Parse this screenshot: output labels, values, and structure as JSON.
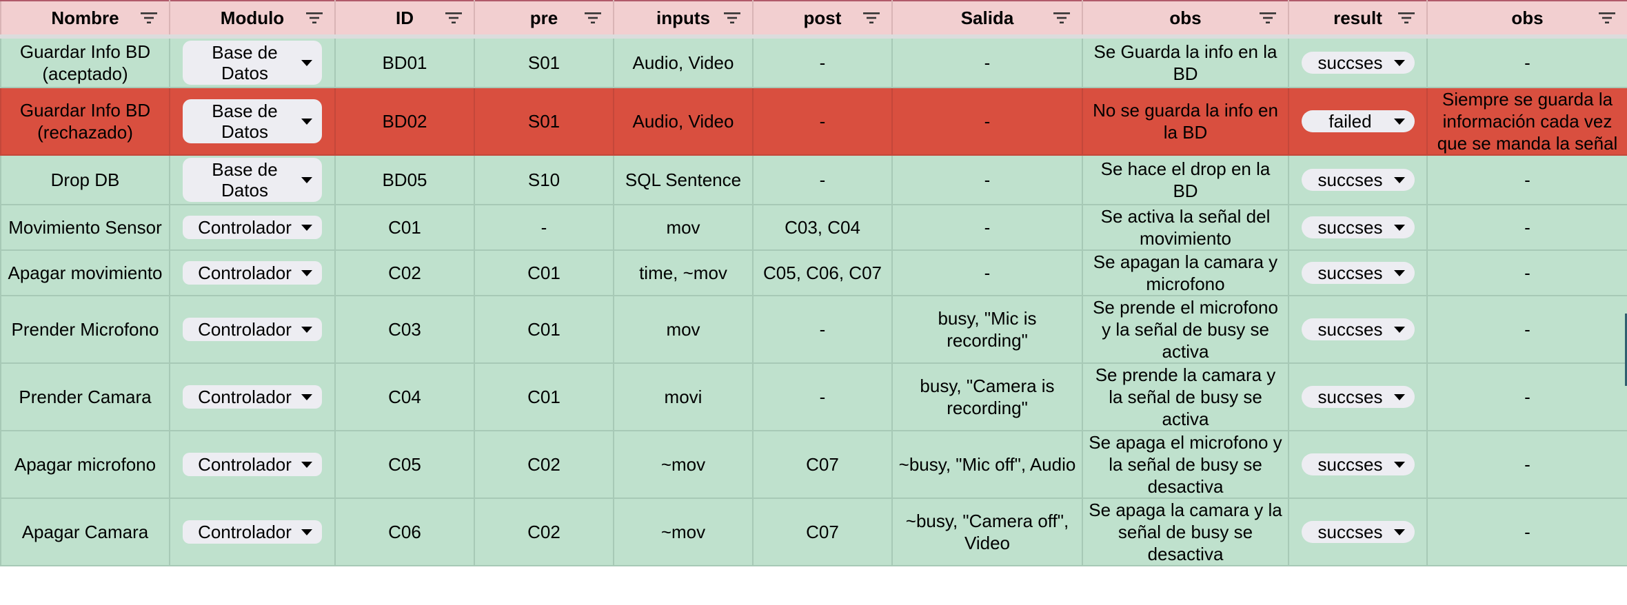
{
  "columns": [
    {
      "label": "Nombre",
      "icon": "filter-icon"
    },
    {
      "label": "Modulo",
      "icon": "filter-icon"
    },
    {
      "label": "ID",
      "icon": "filter-icon"
    },
    {
      "label": "pre",
      "icon": "filter-icon"
    },
    {
      "label": "inputs",
      "icon": "filter-icon"
    },
    {
      "label": "post",
      "icon": "filter-icon"
    },
    {
      "label": "Salida",
      "icon": "filter-icon"
    },
    {
      "label": "obs",
      "icon": "filter-icon"
    },
    {
      "label": "result",
      "icon": "filter-icon"
    },
    {
      "label": "obs",
      "icon": "filter-icon"
    }
  ],
  "rows": [
    {
      "nombre": "Guardar Info BD (aceptado)",
      "modulo": "Base de Datos",
      "id": "BD01",
      "pre": "S01",
      "inputs": "Audio, Video",
      "post": "-",
      "salida": "-",
      "obs": "Se Guarda la info en la BD",
      "result": "succses",
      "obs2": "-",
      "status": "ok"
    },
    {
      "nombre": "Guardar Info BD (rechazado)",
      "modulo": "Base de Datos",
      "id": "BD02",
      "pre": "S01",
      "inputs": "Audio, Video",
      "post": "-",
      "salida": "-",
      "obs": "No se guarda la info en la BD",
      "result": "failed",
      "obs2": "Siempre se guarda la información cada vez que se manda la señal",
      "status": "failed"
    },
    {
      "nombre": "Drop DB",
      "modulo": "Base de Datos",
      "id": "BD05",
      "pre": "S10",
      "inputs": "SQL Sentence",
      "post": "-",
      "salida": "-",
      "obs": "Se hace el drop en la BD",
      "result": "succses",
      "obs2": "-",
      "status": "ok"
    },
    {
      "nombre": "Movimiento Sensor",
      "modulo": "Controlador",
      "id": "C01",
      "pre": "-",
      "inputs": "mov",
      "post": "C03, C04",
      "salida": "-",
      "obs": "Se activa la señal del movimiento",
      "result": "succses",
      "obs2": "-",
      "status": "ok"
    },
    {
      "nombre": "Apagar movimiento",
      "modulo": "Controlador",
      "id": "C02",
      "pre": "C01",
      "inputs": "time, ~mov",
      "post": "C05, C06, C07",
      "salida": "-",
      "obs": "Se apagan la camara y microfono",
      "result": "succses",
      "obs2": "-",
      "status": "ok"
    },
    {
      "nombre": "Prender Microfono",
      "modulo": "Controlador",
      "id": "C03",
      "pre": "C01",
      "inputs": "mov",
      "post": "-",
      "salida": "busy, \"Mic is recording\"",
      "obs": "Se prende el microfono y la señal de busy se activa",
      "result": "succses",
      "obs2": "-",
      "status": "ok"
    },
    {
      "nombre": "Prender Camara",
      "modulo": "Controlador",
      "id": "C04",
      "pre": "C01",
      "inputs": "movi",
      "post": "-",
      "salida": "busy, \"Camera is recording\"",
      "obs": "Se prende la camara y la señal de busy se activa",
      "result": "succses",
      "obs2": "-",
      "status": "ok"
    },
    {
      "nombre": "Apagar microfono",
      "modulo": "Controlador",
      "id": "C05",
      "pre": "C02",
      "inputs": "~mov",
      "post": "C07",
      "salida": "~busy, \"Mic off\", Audio",
      "obs": "Se apaga el microfono y la señal de busy se desactiva",
      "result": "succses",
      "obs2": "-",
      "status": "ok"
    },
    {
      "nombre": "Apagar Camara",
      "modulo": "Controlador",
      "id": "C06",
      "pre": "C02",
      "inputs": "~mov",
      "post": "C07",
      "salida": "~busy, \"Camera off\", Video",
      "obs": "Se apaga la camara y la señal de busy se desactiva",
      "result": "succses",
      "obs2": "-",
      "status": "ok"
    }
  ],
  "colors": {
    "header_bg": "#f2cfd0",
    "row_ok": "#bfe1cd",
    "row_failed": "#d94f3f",
    "chip_bg": "#ededf2"
  }
}
